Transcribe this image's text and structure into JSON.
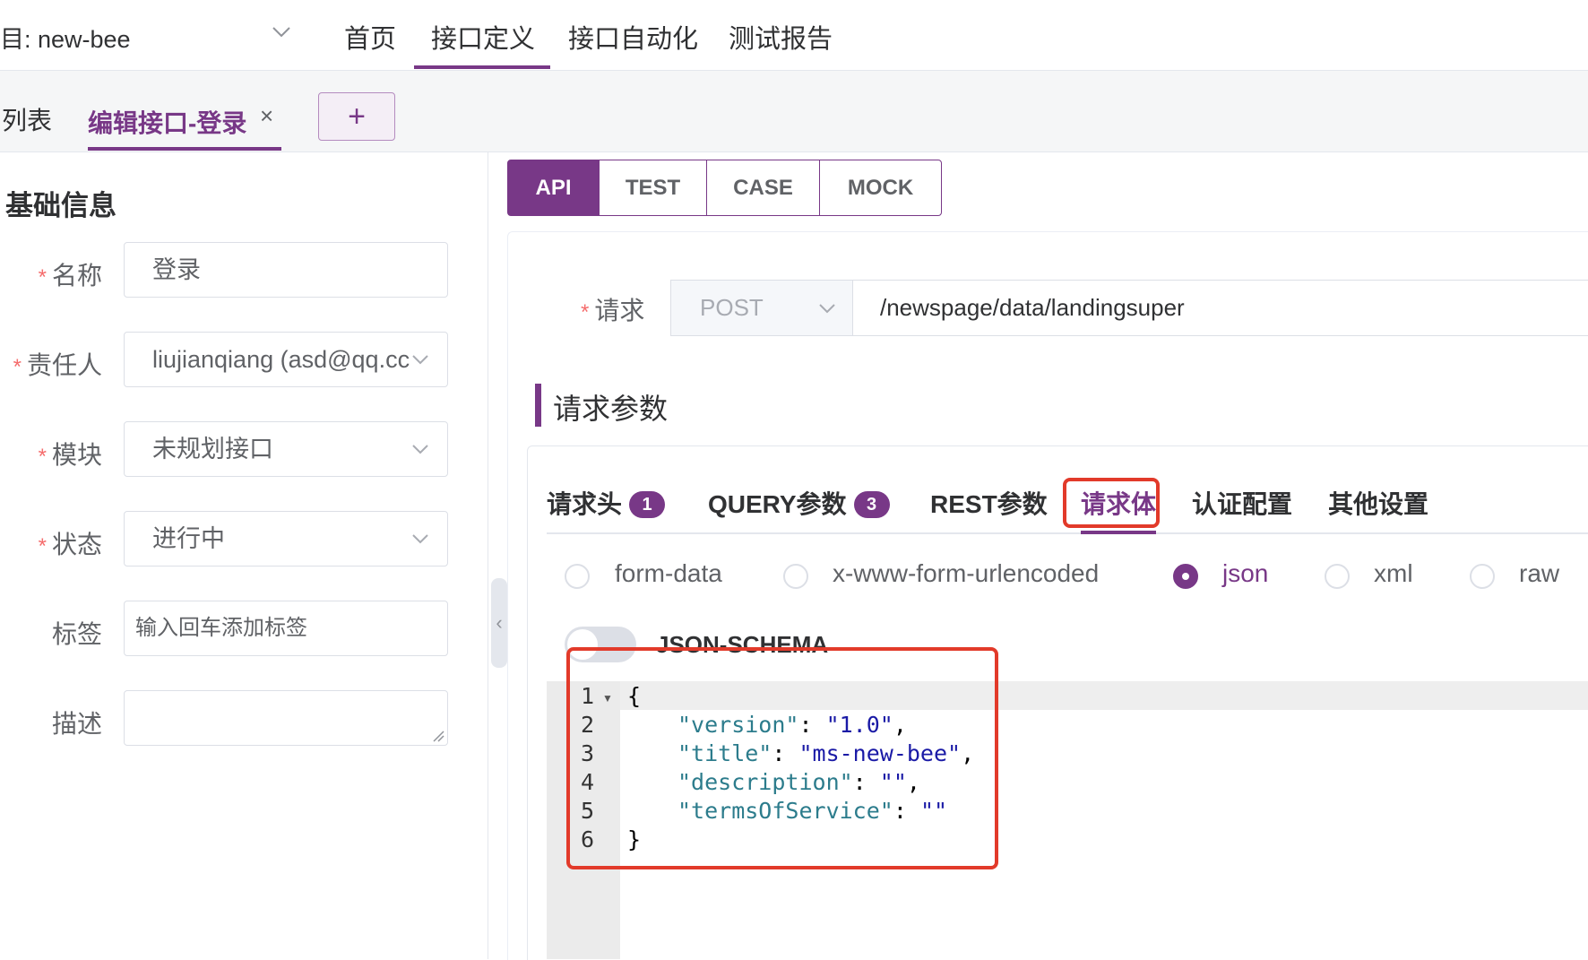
{
  "top_nav": {
    "project": "目: new-bee",
    "tabs": [
      "首页",
      "接口定义",
      "接口自动化",
      "测试报告"
    ]
  },
  "tab_bar": {
    "list_tab": "列表",
    "edit_tab": "编辑接口-登录",
    "close_glyph": "×",
    "add_glyph": "+"
  },
  "basic_info": {
    "title": "基础信息",
    "required_mark": "*",
    "name_label": "名称",
    "name_value": "登录",
    "owner_label": "责任人",
    "owner_value": "liujianqiang (asd@qq.cc",
    "module_label": "模块",
    "module_value": "未规划接口",
    "status_label": "状态",
    "status_value": "进行中",
    "tags_label": "标签",
    "tags_placeholder": "输入回车添加标签",
    "desc_label": "描述",
    "desc_value": ""
  },
  "splitter_glyph": "‹",
  "mode_tabs": [
    "API",
    "TEST",
    "CASE",
    "MOCK"
  ],
  "request": {
    "label": "请求",
    "method": "POST",
    "url": "/newspage/data/landingsuper"
  },
  "params": {
    "title": "请求参数",
    "tabs": {
      "headers": "请求头",
      "headers_count": "1",
      "query": "QUERY参数",
      "query_count": "3",
      "rest": "REST参数",
      "body": "请求体",
      "auth": "认证配置",
      "other": "其他设置"
    },
    "body_types": [
      "form-data",
      "x-www-form-urlencoded",
      "json",
      "xml",
      "raw"
    ],
    "body_type_selected": "json",
    "json_schema_label": "JSON-SCHEMA",
    "json_schema_enabled": false
  },
  "editor": {
    "line_numbers": [
      "1",
      "2",
      "3",
      "4",
      "5",
      "6"
    ],
    "lines": {
      "l1": "{",
      "l2_key": "\"version\"",
      "l2_sep": ": ",
      "l2_val": "\"1.0\"",
      "l2_end": ",",
      "l3_key": "\"title\"",
      "l3_sep": ": ",
      "l3_val": "\"ms-new-bee\"",
      "l3_end": ",",
      "l4_key": "\"description\"",
      "l4_sep": ": ",
      "l4_val": "\"\"",
      "l4_end": ",",
      "l5_key": "\"termsOfService\"",
      "l5_sep": ": ",
      "l5_val": "\"\"",
      "l6": "}"
    }
  },
  "colors": {
    "accent": "#783887",
    "highlight_box": "#e23a2a"
  }
}
